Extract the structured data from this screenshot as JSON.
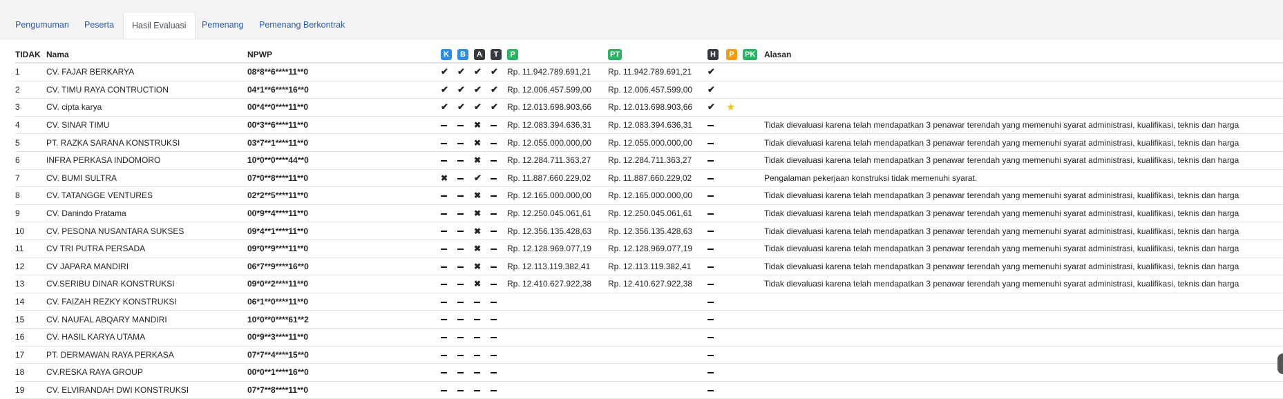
{
  "tabs": [
    {
      "label": "Pengumuman",
      "active": false
    },
    {
      "label": "Peserta",
      "active": false
    },
    {
      "label": "Hasil Evaluasi",
      "active": true
    },
    {
      "label": "Pemenang",
      "active": false
    },
    {
      "label": "Pemenang Berkontrak",
      "active": false
    }
  ],
  "table": {
    "headers": {
      "no": "TIDAK",
      "nama": "Nama",
      "npwp": "NPWP",
      "alasan": "Alasan"
    },
    "eval_badges": [
      {
        "label": "K",
        "color": "#2f8ee0"
      },
      {
        "label": "B",
        "color": "#2f8ee0"
      },
      {
        "label": "A",
        "color": "#343a40"
      },
      {
        "label": "T",
        "color": "#343a40"
      },
      {
        "label": "P",
        "color": "#28b463"
      }
    ],
    "pt_badge": {
      "label": "PT",
      "color": "#28b463"
    },
    "result_badges": [
      {
        "label": "H",
        "color": "#343a40"
      },
      {
        "label": "P",
        "color": "#f39c12"
      },
      {
        "label": "PK",
        "color": "#28b463"
      }
    ],
    "rows": [
      {
        "no": "1",
        "nama": "CV. FAJAR BERKARYA",
        "npwp": "08*8**6****11**0",
        "marks": [
          "check",
          "check",
          "check",
          "check"
        ],
        "penawaran": "Rp. 11.942.789.691,21",
        "terkoreksi": "Rp. 11.942.789.691,21",
        "h": "check",
        "star": false,
        "alasan": ""
      },
      {
        "no": "2",
        "nama": "CV. TIMU RAYA CONTRUCTION",
        "npwp": "04*1**6****16**0",
        "marks": [
          "check",
          "check",
          "check",
          "check"
        ],
        "penawaran": "Rp. 12.006.457.599,00",
        "terkoreksi": "Rp. 12.006.457.599,00",
        "h": "check",
        "star": false,
        "alasan": ""
      },
      {
        "no": "3",
        "nama": "CV. cipta karya",
        "npwp": "00*4**0****11**0",
        "marks": [
          "check",
          "check",
          "check",
          "check"
        ],
        "penawaran": "Rp. 12.013.698.903,66",
        "terkoreksi": "Rp. 12.013.698.903,66",
        "h": "check",
        "star": true,
        "alasan": ""
      },
      {
        "no": "4",
        "nama": "CV. SINAR TIMU",
        "npwp": "00*3**6****11**0",
        "marks": [
          "dash",
          "dash",
          "cross",
          "dash"
        ],
        "penawaran": "Rp. 12.083.394.636,31",
        "terkoreksi": "Rp. 12.083.394.636,31",
        "h": "dash",
        "star": false,
        "alasan": "Tidak dievaluasi karena telah mendapatkan 3 penawar terendah yang memenuhi syarat administrasi, kualifikasi, teknis dan harga"
      },
      {
        "no": "5",
        "nama": "PT. RAZKA SARANA KONSTRUKSI",
        "npwp": "03*7**1****11**0",
        "marks": [
          "dash",
          "dash",
          "cross",
          "dash"
        ],
        "penawaran": "Rp. 12.055.000.000,00",
        "terkoreksi": "Rp. 12.055.000.000,00",
        "h": "dash",
        "star": false,
        "alasan": "Tidak dievaluasi karena telah mendapatkan 3 penawar terendah yang memenuhi syarat administrasi, kualifikasi, teknis dan harga"
      },
      {
        "no": "6",
        "nama": "INFRA PERKASA INDOMORO",
        "npwp": "10*0**0****44**0",
        "marks": [
          "dash",
          "dash",
          "cross",
          "dash"
        ],
        "penawaran": "Rp. 12.284.711.363,27",
        "terkoreksi": "Rp. 12.284.711.363,27",
        "h": "dash",
        "star": false,
        "alasan": "Tidak dievaluasi karena telah mendapatkan 3 penawar terendah yang memenuhi syarat administrasi, kualifikasi, teknis dan harga"
      },
      {
        "no": "7",
        "nama": "CV. BUMI SULTRA",
        "npwp": "07*0**8****11**0",
        "marks": [
          "cross",
          "dash",
          "check",
          "dash"
        ],
        "penawaran": "Rp. 11.887.660.229,02",
        "terkoreksi": "Rp. 11.887.660.229,02",
        "h": "dash",
        "star": false,
        "alasan": "Pengalaman pekerjaan konstruksi tidak memenuhi syarat."
      },
      {
        "no": "8",
        "nama": "CV. TATANGGE VENTURES",
        "npwp": "02*2**5****11**0",
        "marks": [
          "dash",
          "dash",
          "cross",
          "dash"
        ],
        "penawaran": "Rp. 12.165.000.000,00",
        "terkoreksi": "Rp. 12.165.000.000,00",
        "h": "dash",
        "star": false,
        "alasan": "Tidak dievaluasi karena telah mendapatkan 3 penawar terendah yang memenuhi syarat administrasi, kualifikasi, teknis dan harga"
      },
      {
        "no": "9",
        "nama": "CV. Danindo Pratama",
        "npwp": "00*9**4****11**0",
        "marks": [
          "dash",
          "dash",
          "cross",
          "dash"
        ],
        "penawaran": "Rp. 12.250.045.061,61",
        "terkoreksi": "Rp. 12.250.045.061,61",
        "h": "dash",
        "star": false,
        "alasan": "Tidak dievaluasi karena telah mendapatkan 3 penawar terendah yang memenuhi syarat administrasi, kualifikasi, teknis dan harga"
      },
      {
        "no": "10",
        "nama": "CV. PESONA NUSANTARA SUKSES",
        "npwp": "09*4**1****11**0",
        "marks": [
          "dash",
          "dash",
          "cross",
          "dash"
        ],
        "penawaran": "Rp. 12.356.135.428,63",
        "terkoreksi": "Rp. 12.356.135.428,63",
        "h": "dash",
        "star": false,
        "alasan": "Tidak dievaluasi karena telah mendapatkan 3 penawar terendah yang memenuhi syarat administrasi, kualifikasi, teknis dan harga"
      },
      {
        "no": "11",
        "nama": "CV TRI PUTRA PERSADA",
        "npwp": "09*0**9****11**0",
        "marks": [
          "dash",
          "dash",
          "cross",
          "dash"
        ],
        "penawaran": "Rp. 12.128.969.077,19",
        "terkoreksi": "Rp. 12.128.969.077,19",
        "h": "dash",
        "star": false,
        "alasan": "Tidak dievaluasi karena telah mendapatkan 3 penawar terendah yang memenuhi syarat administrasi, kualifikasi, teknis dan harga"
      },
      {
        "no": "12",
        "nama": "CV JAPARA MANDIRI",
        "npwp": "06*7**9****16**0",
        "marks": [
          "dash",
          "dash",
          "cross",
          "dash"
        ],
        "penawaran": "Rp. 12.113.119.382,41",
        "terkoreksi": "Rp. 12.113.119.382,41",
        "h": "dash",
        "star": false,
        "alasan": "Tidak dievaluasi karena telah mendapatkan 3 penawar terendah yang memenuhi syarat administrasi, kualifikasi, teknis dan harga"
      },
      {
        "no": "13",
        "nama": "CV.SERIBU DINAR KONSTRUKSI",
        "npwp": "09*0**2****11**0",
        "marks": [
          "dash",
          "dash",
          "cross",
          "dash"
        ],
        "penawaran": "Rp. 12.410.627.922,38",
        "terkoreksi": "Rp. 12.410.627.922,38",
        "h": "dash",
        "star": false,
        "alasan": "Tidak dievaluasi karena telah mendapatkan 3 penawar terendah yang memenuhi syarat administrasi, kualifikasi, teknis dan harga"
      },
      {
        "no": "14",
        "nama": "CV. FAIZAH REZKY KONSTRUKSI",
        "npwp": "06*1**0****11**0",
        "marks": [
          "dash",
          "dash",
          "dash",
          "dash"
        ],
        "penawaran": "",
        "terkoreksi": "",
        "h": "dash",
        "star": false,
        "alasan": ""
      },
      {
        "no": "15",
        "nama": "CV. NAUFAL ABQARY MANDIRI",
        "npwp": "10*0**0****61**2",
        "marks": [
          "dash",
          "dash",
          "dash",
          "dash"
        ],
        "penawaran": "",
        "terkoreksi": "",
        "h": "dash",
        "star": false,
        "alasan": ""
      },
      {
        "no": "16",
        "nama": "CV. HASIL KARYA UTAMA",
        "npwp": "00*9**3****11**0",
        "marks": [
          "dash",
          "dash",
          "dash",
          "dash"
        ],
        "penawaran": "",
        "terkoreksi": "",
        "h": "dash",
        "star": false,
        "alasan": ""
      },
      {
        "no": "17",
        "nama": "PT. DERMAWAN RAYA PERKASA",
        "npwp": "07*7**4****15**0",
        "marks": [
          "dash",
          "dash",
          "dash",
          "dash"
        ],
        "penawaran": "",
        "terkoreksi": "",
        "h": "dash",
        "star": false,
        "alasan": ""
      },
      {
        "no": "18",
        "nama": "CV.RESKA RAYA GROUP",
        "npwp": "00*0**1****16**0",
        "marks": [
          "dash",
          "dash",
          "dash",
          "dash"
        ],
        "penawaran": "",
        "terkoreksi": "",
        "h": "dash",
        "star": false,
        "alasan": ""
      },
      {
        "no": "19",
        "nama": "CV. ELVIRANDAH DWI KONSTRUKSI",
        "npwp": "07*7**8****11**0",
        "marks": [
          "dash",
          "dash",
          "dash",
          "dash"
        ],
        "penawaran": "",
        "terkoreksi": "",
        "h": "dash",
        "star": false,
        "alasan": ""
      }
    ]
  }
}
